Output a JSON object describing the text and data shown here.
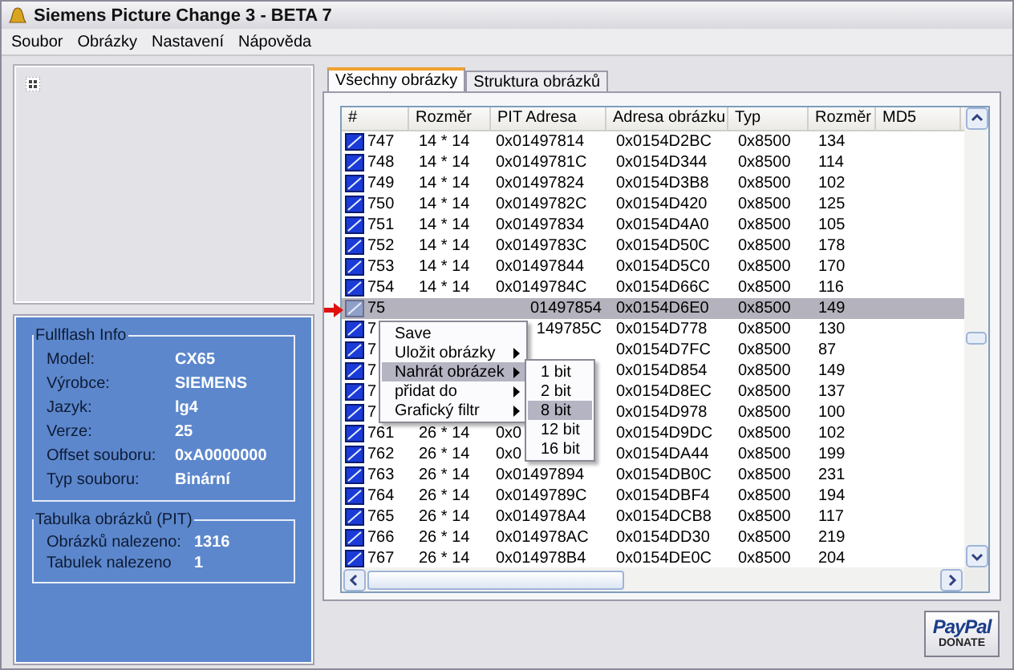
{
  "window": {
    "title": "Siemens Picture Change 3 - BETA 7"
  },
  "menu": [
    "Soubor",
    "Obrázky",
    "Nastavení",
    "Nápověda"
  ],
  "info": {
    "title": "Fullflash Info",
    "fields": [
      {
        "label": "Model:",
        "value": "CX65"
      },
      {
        "label": "Výrobce:",
        "value": "SIEMENS"
      },
      {
        "label": "Jazyk:",
        "value": "lg4"
      },
      {
        "label": "Verze:",
        "value": "25"
      },
      {
        "label": "Offset souboru:",
        "value": "0xA0000000"
      },
      {
        "label": "Typ souboru:",
        "value": "Binární"
      }
    ]
  },
  "pit": {
    "title": "Tabulka obrázků (PIT)",
    "fields": [
      {
        "label": "Obrázků nalezeno:",
        "value": "1316"
      },
      {
        "label": "Tabulek nalezeno",
        "value": "1"
      }
    ]
  },
  "tabs": [
    {
      "label": "Všechny obrázky",
      "selected": true
    },
    {
      "label": "Struktura obrázků",
      "selected": false
    }
  ],
  "table": {
    "columns": [
      "#",
      "Rozměr",
      "PIT Adresa",
      "Adresa obrázku",
      "Typ",
      "Rozměr",
      "MD5"
    ],
    "rows": [
      {
        "kind": "full",
        "selected": false,
        "num": "747",
        "size": "14 * 14",
        "pit": "0x01497814",
        "addr": "0x0154D2BC",
        "type": "0x8500",
        "bytes": "134"
      },
      {
        "kind": "full",
        "selected": false,
        "num": "748",
        "size": "14 * 14",
        "pit": "0x0149781C",
        "addr": "0x0154D344",
        "type": "0x8500",
        "bytes": "114"
      },
      {
        "kind": "full",
        "selected": false,
        "num": "749",
        "size": "14 * 14",
        "pit": "0x01497824",
        "addr": "0x0154D3B8",
        "type": "0x8500",
        "bytes": "102"
      },
      {
        "kind": "full",
        "selected": false,
        "num": "750",
        "size": "14 * 14",
        "pit": "0x0149782C",
        "addr": "0x0154D420",
        "type": "0x8500",
        "bytes": "125"
      },
      {
        "kind": "full",
        "selected": false,
        "num": "751",
        "size": "14 * 14",
        "pit": "0x01497834",
        "addr": "0x0154D4A0",
        "type": "0x8500",
        "bytes": "105"
      },
      {
        "kind": "full",
        "selected": false,
        "num": "752",
        "size": "14 * 14",
        "pit": "0x0149783C",
        "addr": "0x0154D50C",
        "type": "0x8500",
        "bytes": "178"
      },
      {
        "kind": "full",
        "selected": false,
        "num": "753",
        "size": "14 * 14",
        "pit": "0x01497844",
        "addr": "0x0154D5C0",
        "type": "0x8500",
        "bytes": "170"
      },
      {
        "kind": "full",
        "selected": false,
        "num": "754",
        "size": "14 * 14",
        "pit": "0x0149784C",
        "addr": "0x0154D66C",
        "type": "0x8500",
        "bytes": "116"
      },
      {
        "kind": "covered",
        "selected": true,
        "num": "75",
        "pit": "01497854",
        "addr": "0x0154D6E0",
        "type": "0x8500",
        "bytes": "149"
      },
      {
        "kind": "covered",
        "selected": false,
        "num": "7",
        "pit": "149785C",
        "addr": "0x0154D778",
        "type": "0x8500",
        "bytes": "130"
      },
      {
        "kind": "covered",
        "selected": false,
        "num": "7",
        "addr": "0x0154D7FC",
        "type": "0x8500",
        "bytes": "87"
      },
      {
        "kind": "covered",
        "selected": false,
        "num": "7",
        "addr": "0x0154D854",
        "type": "0x8500",
        "bytes": "149"
      },
      {
        "kind": "covered",
        "selected": false,
        "num": "7",
        "addr": "0x0154D8EC",
        "type": "0x8500",
        "bytes": "137"
      },
      {
        "kind": "covered",
        "selected": false,
        "num": "7",
        "addr": "0x0154D978",
        "type": "0x8500",
        "bytes": "100"
      },
      {
        "kind": "full",
        "selected": false,
        "num": "761",
        "size": "26 * 14",
        "pit": "0x0",
        "addr": "0x0154D9DC",
        "type": "0x8500",
        "bytes": "102"
      },
      {
        "kind": "full",
        "selected": false,
        "num": "762",
        "size": "26 * 14",
        "pit": "0x0",
        "addr": "0x0154DA44",
        "type": "0x8500",
        "bytes": "199"
      },
      {
        "kind": "full",
        "selected": false,
        "num": "763",
        "size": "26 * 14",
        "pit": "0x01497894",
        "addr": "0x0154DB0C",
        "type": "0x8500",
        "bytes": "231"
      },
      {
        "kind": "full",
        "selected": false,
        "num": "764",
        "size": "26 * 14",
        "pit": "0x0149789C",
        "addr": "0x0154DBF4",
        "type": "0x8500",
        "bytes": "194"
      },
      {
        "kind": "full",
        "selected": false,
        "num": "765",
        "size": "26 * 14",
        "pit": "0x014978A4",
        "addr": "0x0154DCB8",
        "type": "0x8500",
        "bytes": "117"
      },
      {
        "kind": "full",
        "selected": false,
        "num": "766",
        "size": "26 * 14",
        "pit": "0x014978AC",
        "addr": "0x0154DD30",
        "type": "0x8500",
        "bytes": "219"
      },
      {
        "kind": "full",
        "selected": false,
        "num": "767",
        "size": "26 * 14",
        "pit": "0x014978B4",
        "addr": "0x0154DE0C",
        "type": "0x8500",
        "bytes": "204"
      }
    ]
  },
  "context_menu": {
    "items": [
      {
        "label": "Save",
        "submenu": false,
        "selected": false
      },
      {
        "label": "Uložit obrázky",
        "submenu": true,
        "selected": false
      },
      {
        "label": "Nahrát obrázek",
        "submenu": true,
        "selected": true
      },
      {
        "label": "přidat do",
        "submenu": true,
        "selected": false
      },
      {
        "label": "Grafický filtr",
        "submenu": true,
        "selected": false
      }
    ],
    "submenu": [
      {
        "label": "1 bit",
        "selected": false
      },
      {
        "label": "2 bit",
        "selected": false
      },
      {
        "label": "8 bit",
        "selected": true
      },
      {
        "label": "12 bit",
        "selected": false
      },
      {
        "label": "16 bit",
        "selected": false
      }
    ]
  },
  "donate": {
    "brand": "PayPal",
    "label": "DONATE"
  }
}
